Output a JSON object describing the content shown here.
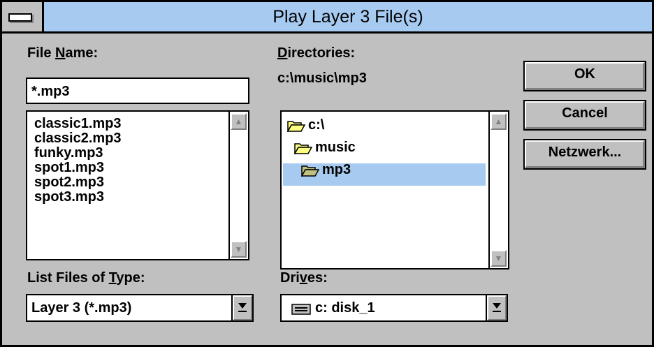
{
  "window": {
    "title": "Play Layer 3 File(s)"
  },
  "file_name": {
    "label_pre": "File ",
    "label_u": "N",
    "label_post": "ame:",
    "value": "*.mp3",
    "files": [
      "classic1.mp3",
      "classic2.mp3",
      "funky.mp3",
      "spot1.mp3",
      "spot2.mp3",
      "spot3.mp3"
    ]
  },
  "directories": {
    "label_u": "D",
    "label_post": "irectories:",
    "current_path": "c:\\music\\mp3",
    "tree": [
      "c:\\",
      "music",
      "mp3"
    ],
    "selected": "mp3"
  },
  "file_type": {
    "label_pre": "List Files of ",
    "label_u": "T",
    "label_post": "ype:",
    "value": "Layer 3 (*.mp3)"
  },
  "drives": {
    "label_pre": "Dri",
    "label_u": "v",
    "label_post": "es:",
    "value": "c: disk_1"
  },
  "buttons": {
    "ok": "OK",
    "cancel": "Cancel",
    "network": "Netzwerk..."
  },
  "colors": {
    "titlebar": "#a6caf0",
    "face": "#c0c0c0",
    "selection": "#a6caf0"
  }
}
